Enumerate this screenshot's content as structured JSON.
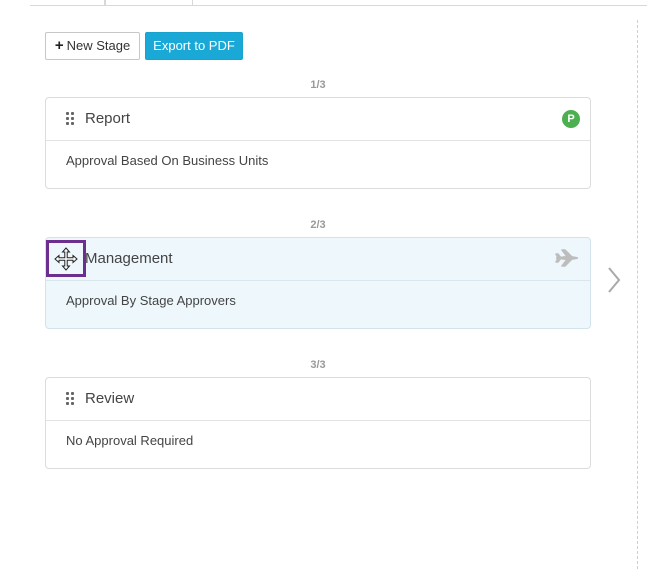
{
  "toolbar": {
    "new_stage_label": "New Stage",
    "export_label": "Export to PDF"
  },
  "stages": [
    {
      "counter": "1/3",
      "title": "Report",
      "description": "Approval Based On Business Units",
      "badge": "P",
      "badge_color": "#4caf50"
    },
    {
      "counter": "2/3",
      "title": "Management",
      "description": "Approval By Stage Approvers",
      "icon": "airplane-icon"
    },
    {
      "counter": "3/3",
      "title": "Review",
      "description": "No Approval Required"
    }
  ],
  "colors": {
    "accent": "#1aa9d6",
    "highlight_border": "#6b2f8f",
    "selected_card_bg": "#eef7fc"
  }
}
